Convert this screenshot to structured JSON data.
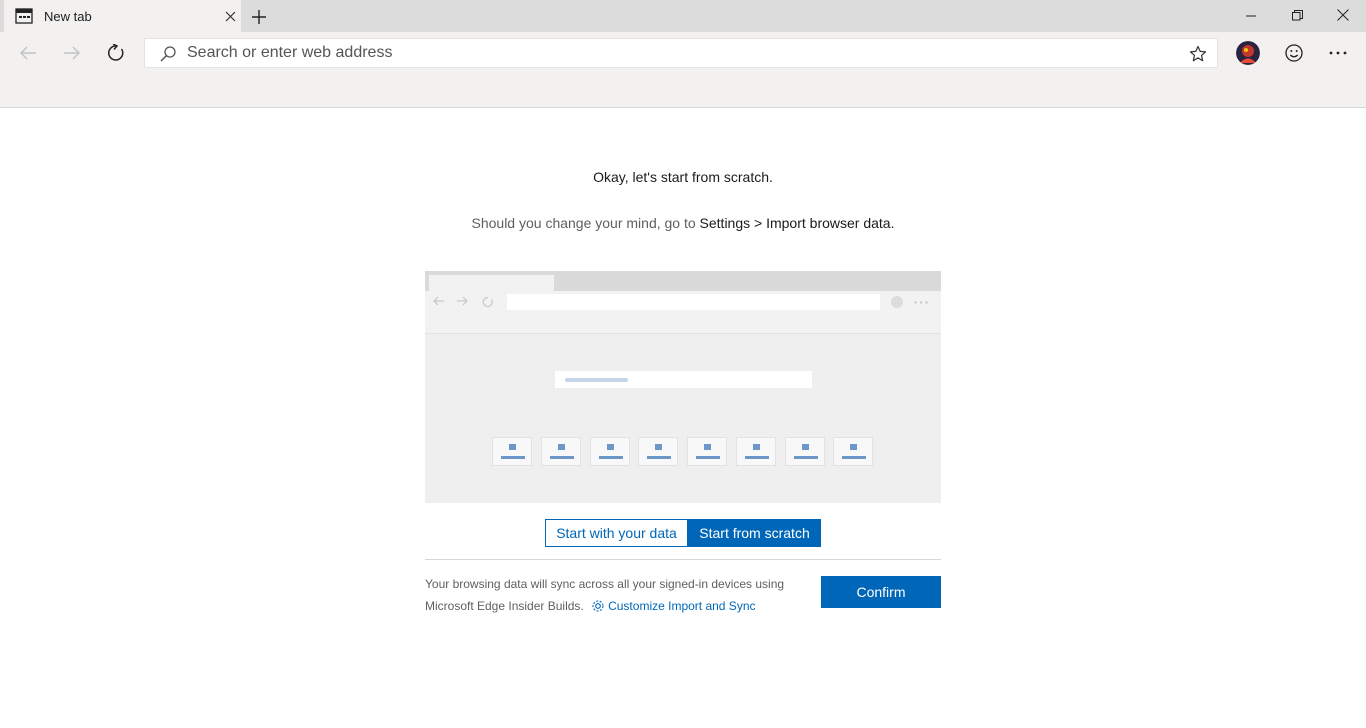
{
  "browser": {
    "tab": {
      "title": "New tab"
    },
    "address_bar": {
      "placeholder": "Search or enter web address",
      "value": ""
    },
    "window_controls": [
      "minimize",
      "restore",
      "close"
    ],
    "toolbar_icons": [
      "back-icon",
      "forward-icon",
      "refresh-icon",
      "favorite-star-icon",
      "profile-avatar",
      "feedback-smiley-icon",
      "more-icon"
    ]
  },
  "content": {
    "heading": "Okay, let's start from scratch.",
    "subtext_prefix": "Should you change your mind, go to",
    "subtext_link": "Settings > Import browser data.",
    "options": {
      "with_data": "Start with your data",
      "from_scratch": "Start from scratch",
      "selected": "from_scratch"
    },
    "info_text": "Your browsing data will sync across all your signed-in devices using Microsoft Edge Insider Builds.",
    "customize_link": "Customize Import and Sync",
    "confirm_label": "Confirm"
  },
  "colors": {
    "accent": "#0067b8",
    "chrome_bg": "#f2f1f0",
    "tabstrip_bg": "#dcdcdc",
    "tile_icon": "#6c97c8"
  }
}
